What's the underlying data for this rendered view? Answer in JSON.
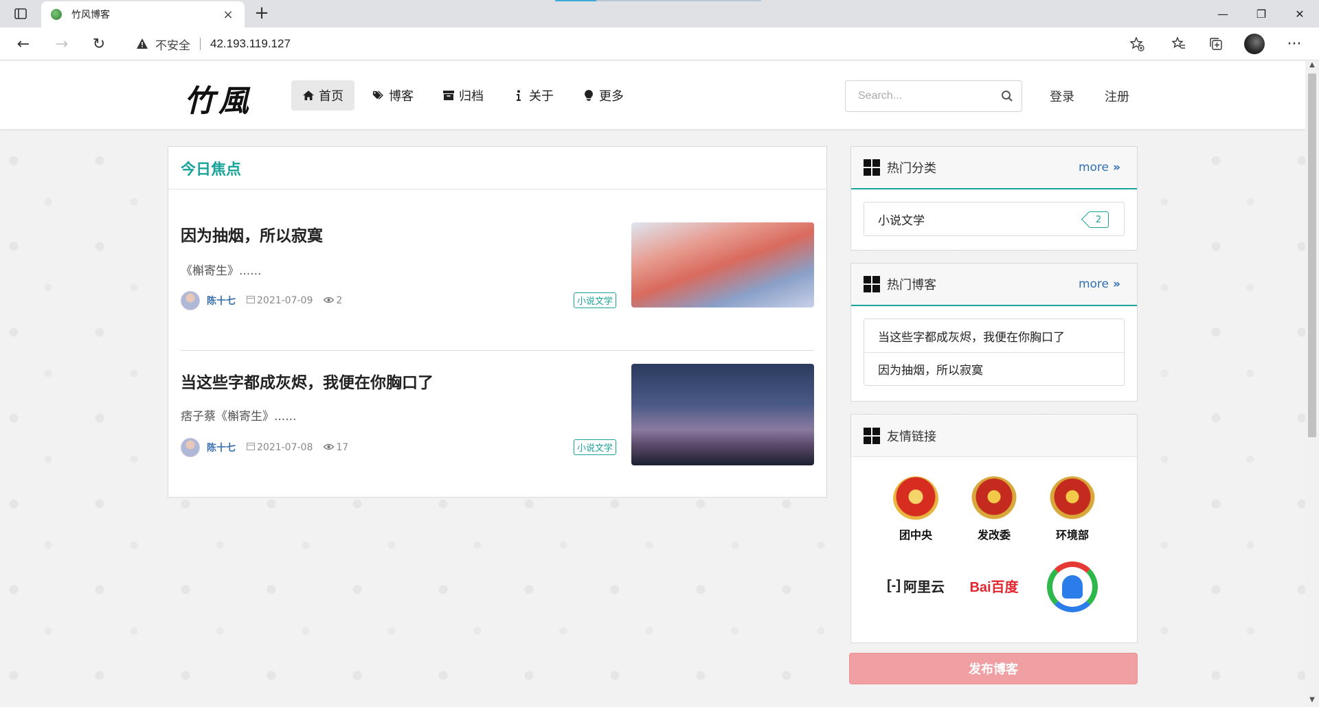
{
  "browser": {
    "tab_title": "竹风博客",
    "new_tab": "+",
    "insecure_label": "不安全",
    "url": "42.193.119.127"
  },
  "site": {
    "logo": "竹風",
    "menu": [
      {
        "label": "首页",
        "icon": "home-icon",
        "active": true
      },
      {
        "label": "博客",
        "icon": "tags-icon",
        "active": false
      },
      {
        "label": "归档",
        "icon": "archive-icon",
        "active": false
      },
      {
        "label": "关于",
        "icon": "info-icon",
        "active": false
      },
      {
        "label": "更多",
        "icon": "lightbulb-icon",
        "active": false
      }
    ],
    "search_placeholder": "Search...",
    "login": "登录",
    "register": "注册"
  },
  "focus": {
    "title": "今日焦点",
    "articles": [
      {
        "title": "因为抽烟，所以寂寞",
        "summary": "《槲寄生》......",
        "author": "陈十七",
        "date": "2021-07-09",
        "views": "2",
        "tag": "小说文学"
      },
      {
        "title": "当这些字都成灰烬，我便在你胸口了",
        "summary": "痞子蔡《槲寄生》......",
        "author": "陈十七",
        "date": "2021-07-08",
        "views": "17",
        "tag": "小说文学"
      }
    ]
  },
  "sidebar": {
    "hot_categories": {
      "title": "热门分类",
      "more": "more",
      "items": [
        {
          "name": "小说文学",
          "count": "2"
        }
      ]
    },
    "hot_blogs": {
      "title": "热门博客",
      "more": "more",
      "items": [
        "当这些字都成灰烬，我便在你胸口了",
        "因为抽烟，所以寂寞"
      ]
    },
    "friend_links": {
      "title": "友情链接",
      "items": [
        {
          "label": "团中央",
          "icon": "youth-league-emblem-icon"
        },
        {
          "label": "发改委",
          "icon": "national-emblem-icon"
        },
        {
          "label": "环境部",
          "icon": "national-emblem-icon"
        },
        {
          "label": "阿里云",
          "icon": "aliyun-logo-icon"
        },
        {
          "label": "Bai百度",
          "icon": "baidu-logo-icon"
        },
        {
          "label": "",
          "icon": "tencent-news-logo-icon"
        }
      ]
    },
    "publish_button": "发布博客"
  },
  "colors": {
    "accent": "#1aa39b",
    "link": "#2f6fb5",
    "publish": "#f0a0a3"
  }
}
